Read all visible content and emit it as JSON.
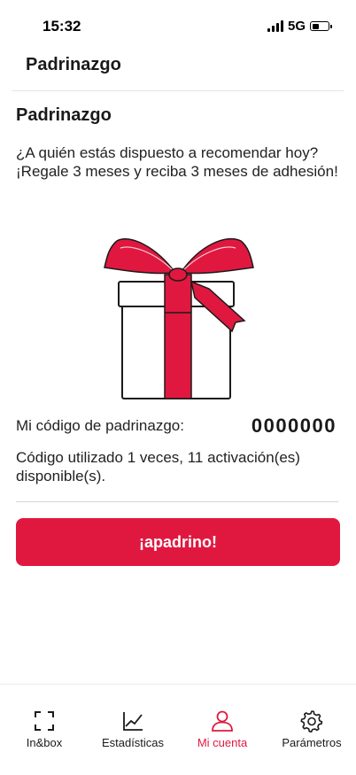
{
  "status_bar": {
    "time": "15:32",
    "network": "5G"
  },
  "header": {
    "title": "Padrinazgo"
  },
  "main": {
    "section_title": "Padrinazgo",
    "intro_line1": "¿A quién estás dispuesto a recomendar hoy?",
    "intro_line2": "¡Regale 3 meses y reciba 3 meses de adhesión!",
    "code_label": "Mi código de padrinazgo:",
    "code_value": "0000000",
    "usage_text": "Código utilizado 1 veces, 11 activación(es) disponible(s).",
    "button_label": "¡apadrino!"
  },
  "nav": {
    "items": [
      {
        "label": "In&box",
        "icon": "scan-frame-icon",
        "active": false
      },
      {
        "label": "Estadísticas",
        "icon": "line-chart-icon",
        "active": false
      },
      {
        "label": "Mi cuenta",
        "icon": "user-icon",
        "active": true
      },
      {
        "label": "Parámetros",
        "icon": "gear-icon",
        "active": false
      }
    ]
  },
  "colors": {
    "accent": "#e0183f",
    "text": "#1a1a1a",
    "divider": "#e4e4e4"
  }
}
